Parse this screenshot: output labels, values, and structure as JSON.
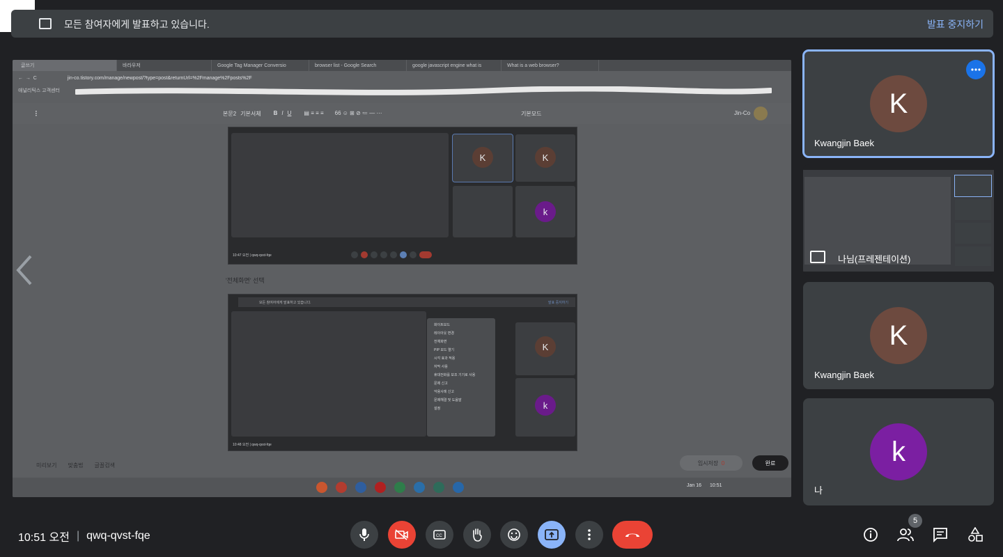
{
  "banner": {
    "message": "모든 참여자에게 발표하고 있습니다.",
    "stop_label": "발표 중지하기"
  },
  "stage": {
    "tabs": [
      "글쓰기",
      "바라우저",
      "Google Tag Manager Conversio",
      "browser list - Google Search",
      "google javascript engine what is",
      "What is a web browser?"
    ],
    "url": "jin-co.tistory.com/manage/newpost/?type=post&returnUrl=%2Fmanage%2Fposts%2F",
    "bookmark": "애널리틱스 고객센터",
    "editor": {
      "style_menu": "본문2",
      "font_menu": "기본서체",
      "mode": "기본모드",
      "author": "Jin-Co"
    },
    "caption": "'전체화면' 선택",
    "inner_meeting_code": "10:47 오전  |  qwq-qvst-fqe",
    "inner_meeting_code2": "10:48 오전  |  qwq-qvst-fqe",
    "inner_banner": "모든 참여자에게 발표하고 있습니다.",
    "inner_stop": "발표 중지하기",
    "context_menu": [
      "화이트보드",
      "레이아웃 변경",
      "전체화면",
      "PIP 모드 열기",
      "시각 효과 적용",
      "자막 사용",
      "휴대전화를 보조 기기로 사용",
      "문제 신고",
      "악용사례 신고",
      "문제해결 및 도움말",
      "설정"
    ],
    "bottom_tools": [
      "미리보기",
      "맞춤법",
      "글꼴검색"
    ],
    "temp_save": "임시저장",
    "temp_count": "0",
    "done": "완료",
    "shelf_date": "Jan 16",
    "shelf_time": "10:51"
  },
  "tiles": [
    {
      "initial": "K",
      "name": "Kwangjin Baek",
      "color": "#6d4a3f"
    },
    {
      "presenter_label": "나님(프레젠테이션)"
    },
    {
      "initial": "K",
      "name": "Kwangjin Baek",
      "color": "#6d4a3f"
    },
    {
      "initial": "k",
      "name": "나",
      "color": "#7b1fa2"
    }
  ],
  "controls": {
    "time": "10:51 오전",
    "separator": "|",
    "meeting_code": "qwq-qvst-fqe",
    "participant_count": "5"
  },
  "icons": [
    "list-icon",
    "present-screen-icon",
    "more-icon",
    "microphone-icon",
    "camera-off-icon",
    "captions-icon",
    "raise-hand-icon",
    "emoji-icon",
    "present-icon",
    "more-vert-icon",
    "end-call-icon",
    "info-icon",
    "people-icon",
    "chat-icon",
    "activities-icon",
    "chevron-left-icon"
  ]
}
